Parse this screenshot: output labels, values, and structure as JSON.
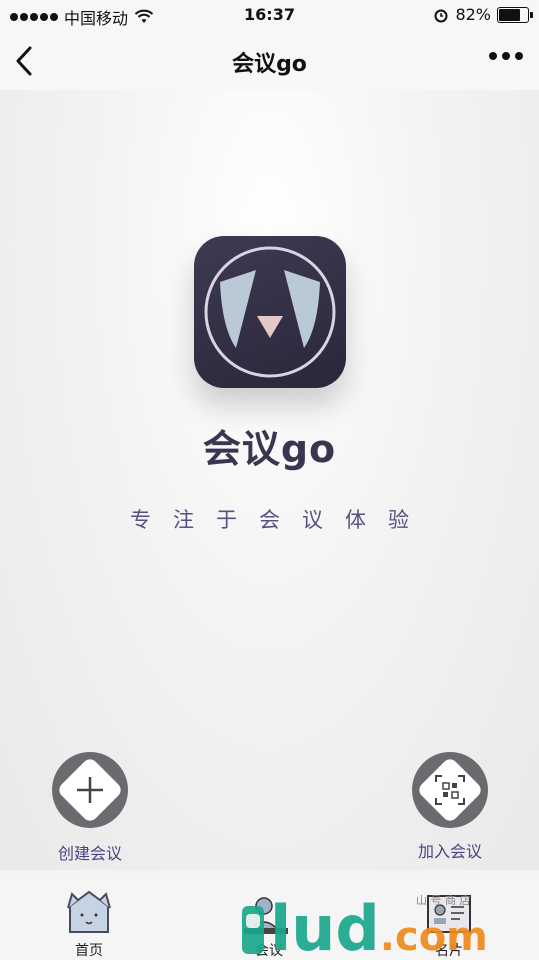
{
  "status_bar": {
    "carrier": "中国移动",
    "time": "16:37",
    "battery_percent": "82%",
    "battery_level": 0.82,
    "icons": [
      "signal-dots-icon",
      "wifi-icon",
      "alarm-icon",
      "battery-icon"
    ]
  },
  "nav": {
    "title": "会议go",
    "back_icon": "chevron-left-icon",
    "more_icon": "more-dots-icon"
  },
  "hero": {
    "app_name": "会议go",
    "slogan": "专注于会议体验",
    "icon": "app-logo-icon"
  },
  "actions": {
    "create_label": "创建会议",
    "join_label": "加入会议",
    "create_icon": "plus-icon",
    "join_icon": "qr-scan-icon"
  },
  "tabs": [
    {
      "label": "首页",
      "icon": "house-icon"
    },
    {
      "label": "会议",
      "icon": "meeting-person-icon"
    },
    {
      "label": "名片",
      "icon": "business-card-icon"
    }
  ],
  "watermark": {
    "text": "lud.com",
    "small_text": "山 号 商 店"
  },
  "colors": {
    "accent_purple": "#5b4e82",
    "logo_dark": "#2f2b40",
    "logo_light_blue": "#b9cad6",
    "logo_pink": "#e4c9c9",
    "watermark_teal": "#1aa78c",
    "watermark_orange": "#f08a1c"
  }
}
